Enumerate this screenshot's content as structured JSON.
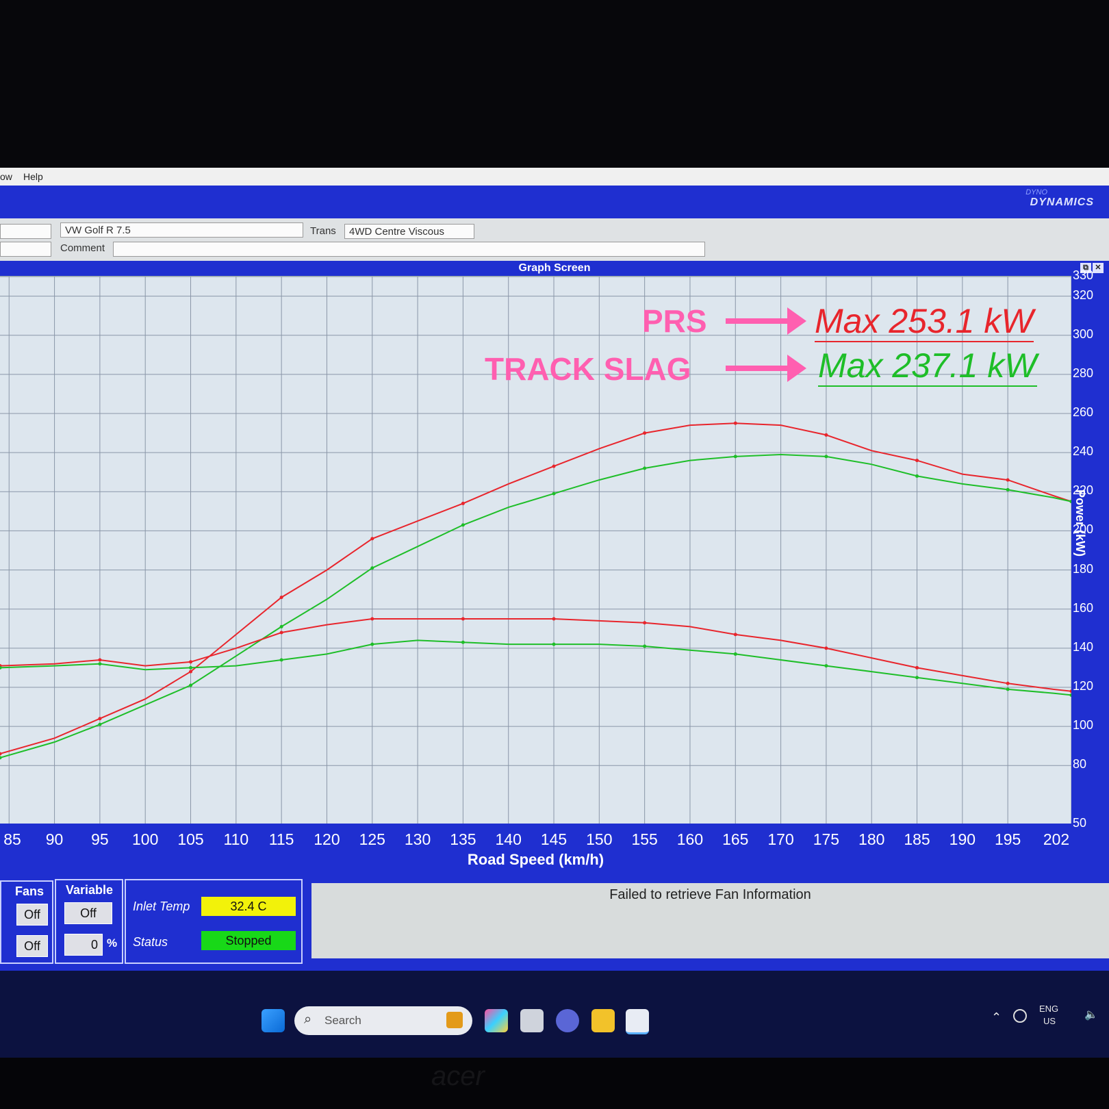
{
  "menu": {
    "item_partial": "ow",
    "help": "Help"
  },
  "header": {
    "brand_top": "DYNO",
    "brand": "DYNAMICS",
    "vehicle": "VW Golf R 7.5",
    "comment_label": "Comment",
    "comment_value": "",
    "trans_label": "Trans",
    "trans_value": "4WD Centre Viscous"
  },
  "graph": {
    "window_title": "Graph Screen",
    "window_buttons": [
      "⧉",
      "✕"
    ],
    "xlabel": "Road Speed (km/h)",
    "x_ticks": [
      "85",
      "90",
      "95",
      "100",
      "105",
      "110",
      "115",
      "120",
      "125",
      "130",
      "135",
      "140",
      "145",
      "150",
      "155",
      "160",
      "165",
      "170",
      "175",
      "180",
      "185",
      "190",
      "195",
      "202"
    ],
    "y_ticks": [
      "330",
      "320",
      "300",
      "280",
      "260",
      "240",
      "220",
      "200",
      "180",
      "160",
      "140",
      "120",
      "100",
      "80",
      "50"
    ],
    "ylabel_partial": "Power (kW)",
    "annotations": {
      "prs_label": "PRS",
      "prs_max": "Max 253.1 kW",
      "track_label": "TRACK SLAG",
      "track_max": "Max 237.1 kW"
    }
  },
  "colors": {
    "red": "#e8252c",
    "green": "#1ebe28",
    "annotation_pink": "#ff5fb0",
    "blue": "#1f2fd0"
  },
  "chart_data": {
    "type": "line",
    "x_range": [
      84,
      202
    ],
    "y_range": [
      50,
      330
    ],
    "series": [
      {
        "name": "PRS",
        "color": "#e8252c",
        "x": [
          84,
          90,
          95,
          100,
          105,
          110,
          115,
          120,
          125,
          130,
          135,
          140,
          145,
          150,
          155,
          160,
          165,
          170,
          175,
          180,
          185,
          190,
          195,
          200,
          202
        ],
        "y": [
          86,
          94,
          104,
          114,
          128,
          147,
          166,
          180,
          196,
          205,
          214,
          224,
          233,
          242,
          250,
          254,
          255,
          254,
          249,
          241,
          236,
          229,
          226,
          218,
          215
        ]
      },
      {
        "name": "TRACK SLAG",
        "color": "#1ebe28",
        "x": [
          84,
          90,
          95,
          100,
          105,
          110,
          115,
          120,
          125,
          130,
          135,
          140,
          145,
          150,
          155,
          160,
          165,
          170,
          175,
          180,
          185,
          190,
          195,
          200,
          202
        ],
        "y": [
          84,
          92,
          101,
          111,
          121,
          136,
          151,
          165,
          181,
          192,
          203,
          212,
          219,
          226,
          232,
          236,
          238,
          239,
          238,
          234,
          228,
          224,
          221,
          217,
          215
        ]
      },
      {
        "x": [
          84,
          90,
          95,
          100,
          105,
          110,
          115,
          120,
          125,
          130,
          135,
          140,
          145,
          150,
          155,
          160,
          165,
          170,
          175,
          180,
          185,
          190,
          195,
          200,
          202
        ],
        "y": [
          131,
          132,
          134,
          131,
          133,
          140,
          148,
          152,
          155,
          155,
          155,
          155,
          155,
          154,
          153,
          151,
          147,
          144,
          140,
          135,
          130,
          126,
          122,
          119,
          118
        ],
        "color": "#e8252c"
      },
      {
        "x": [
          84,
          90,
          95,
          100,
          105,
          110,
          115,
          120,
          125,
          130,
          135,
          140,
          145,
          150,
          155,
          160,
          165,
          170,
          175,
          180,
          185,
          190,
          195,
          200,
          202
        ],
        "y": [
          130,
          131,
          132,
          129,
          130,
          131,
          134,
          137,
          142,
          144,
          143,
          142,
          142,
          142,
          141,
          139,
          137,
          134,
          131,
          128,
          125,
          122,
          119,
          117,
          116
        ],
        "color": "#1ebe28"
      }
    ]
  },
  "footer": {
    "fans_label": "Fans",
    "fans_value_1": "Off",
    "fans_value_2": "Off",
    "variable_label": "Variable",
    "variable_value": "Off",
    "variable_pct": "0",
    "pct_sign": "%",
    "inlet_label": "Inlet Temp",
    "inlet_value": "32.4 C",
    "status_label": "Status",
    "status_value": "Stopped",
    "message": "Failed to retrieve Fan Information"
  },
  "taskbar": {
    "search_placeholder": "Search",
    "lang": "ENG",
    "region": "US"
  },
  "monitor": {
    "brand": "acer"
  }
}
